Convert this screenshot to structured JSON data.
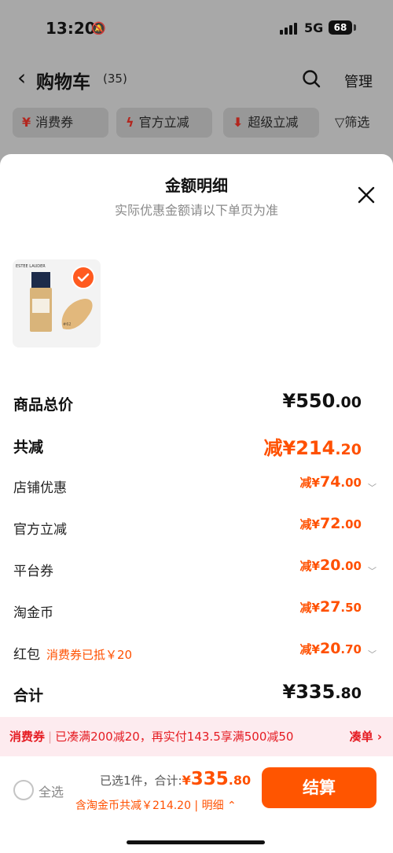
{
  "status_bar": {
    "time": "13:20",
    "network": "5G",
    "battery": "68"
  },
  "nav": {
    "title": "购物车",
    "count": "(35)",
    "manage_label": "管理"
  },
  "chips": [
    {
      "icon": "¥",
      "label": "消费券"
    },
    {
      "icon": "ϟ",
      "label": "官方立减"
    },
    {
      "icon": "⬇",
      "label": "超级立减"
    }
  ],
  "filter_label": "筛选",
  "sheet": {
    "title": "金额明细",
    "subtitle": "实际优惠金额请以下单页为准",
    "product": {
      "brand_text": "ESTEE LAUDER",
      "shade": "#62"
    },
    "rows": [
      {
        "label": "商品总价",
        "prefix": "¥",
        "main": "550",
        "dec": ".00"
      },
      {
        "label": "共减",
        "prefix": "减¥",
        "main": "214",
        "dec": ".20"
      },
      {
        "label": "店铺优惠",
        "prefix": "减¥",
        "main": "74",
        "dec": ".00"
      },
      {
        "label": "官方立减",
        "prefix": "减¥",
        "main": "72",
        "dec": ".00"
      },
      {
        "label": "平台券",
        "prefix": "减¥",
        "main": "20",
        "dec": ".00"
      },
      {
        "label": "淘金币",
        "prefix": "减¥",
        "main": "27",
        "dec": ".50"
      },
      {
        "label": "红包",
        "note": "消费券已抵￥20",
        "prefix": "减¥",
        "main": "20",
        "dec": ".70"
      },
      {
        "label": "合计",
        "prefix": "¥",
        "main": "335",
        "dec": ".80"
      }
    ]
  },
  "promo": {
    "tag": "消费券",
    "text": "已凑满200减20，再实付143.5享满500减50",
    "link": "凑单 ›"
  },
  "bottom": {
    "select_all": "全选",
    "selected": "已选1件，合计:",
    "total_prefix": "¥",
    "total_main": "335",
    "total_dec": ".80",
    "detail": "含淘金币共减￥214.20 | 明细 ⌃",
    "checkout": "结算"
  },
  "colors": {
    "accent": "#ff5000",
    "checkout": "#ff5500",
    "promo_bg": "#fdebef"
  }
}
